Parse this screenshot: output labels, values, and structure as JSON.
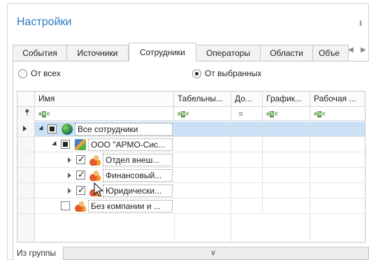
{
  "window": {
    "title": "Настройки",
    "pin_icon": "pin-icon"
  },
  "tabs": [
    {
      "label": "События",
      "active": false
    },
    {
      "label": "Источники",
      "active": false
    },
    {
      "label": "Сотрудники",
      "active": true
    },
    {
      "label": "Операторы",
      "active": false
    },
    {
      "label": "Области",
      "active": false
    },
    {
      "label": "Объе",
      "active": false
    }
  ],
  "radios": {
    "all_label": "От всех",
    "selected_label": "От выбранных",
    "selected": "selected"
  },
  "grid": {
    "columns": [
      "Имя",
      "Табельны...",
      "До...",
      "График...",
      "Рабочая ..."
    ],
    "filter_icon": "filter-pin-icon",
    "rows": [
      {
        "label": "Все сотрудники",
        "icon": "globe-icon",
        "check": "indeterminate",
        "expanded": true,
        "selected": true
      },
      {
        "label": "ООО \"АРМО-Сис...",
        "icon": "organization-icon",
        "check": "indeterminate",
        "expanded": true,
        "selected": false
      },
      {
        "label": "Отдел внеш...",
        "icon": "people-icon",
        "check": "checked",
        "expanded": false,
        "selected": false
      },
      {
        "label": "Финансовый...",
        "icon": "people-icon",
        "check": "checked",
        "expanded": false,
        "selected": false
      },
      {
        "label": "Юридически...",
        "icon": "people-icon",
        "check": "checked",
        "expanded": false,
        "selected": false
      },
      {
        "label": "Без компании и ...",
        "icon": "people-icon",
        "check": "unchecked",
        "expanded": false,
        "selected": false
      }
    ]
  },
  "bottom": {
    "label": "Из группы",
    "value": ""
  },
  "colors": {
    "accent": "#2b78c2",
    "selection": "#c9e0f5"
  }
}
